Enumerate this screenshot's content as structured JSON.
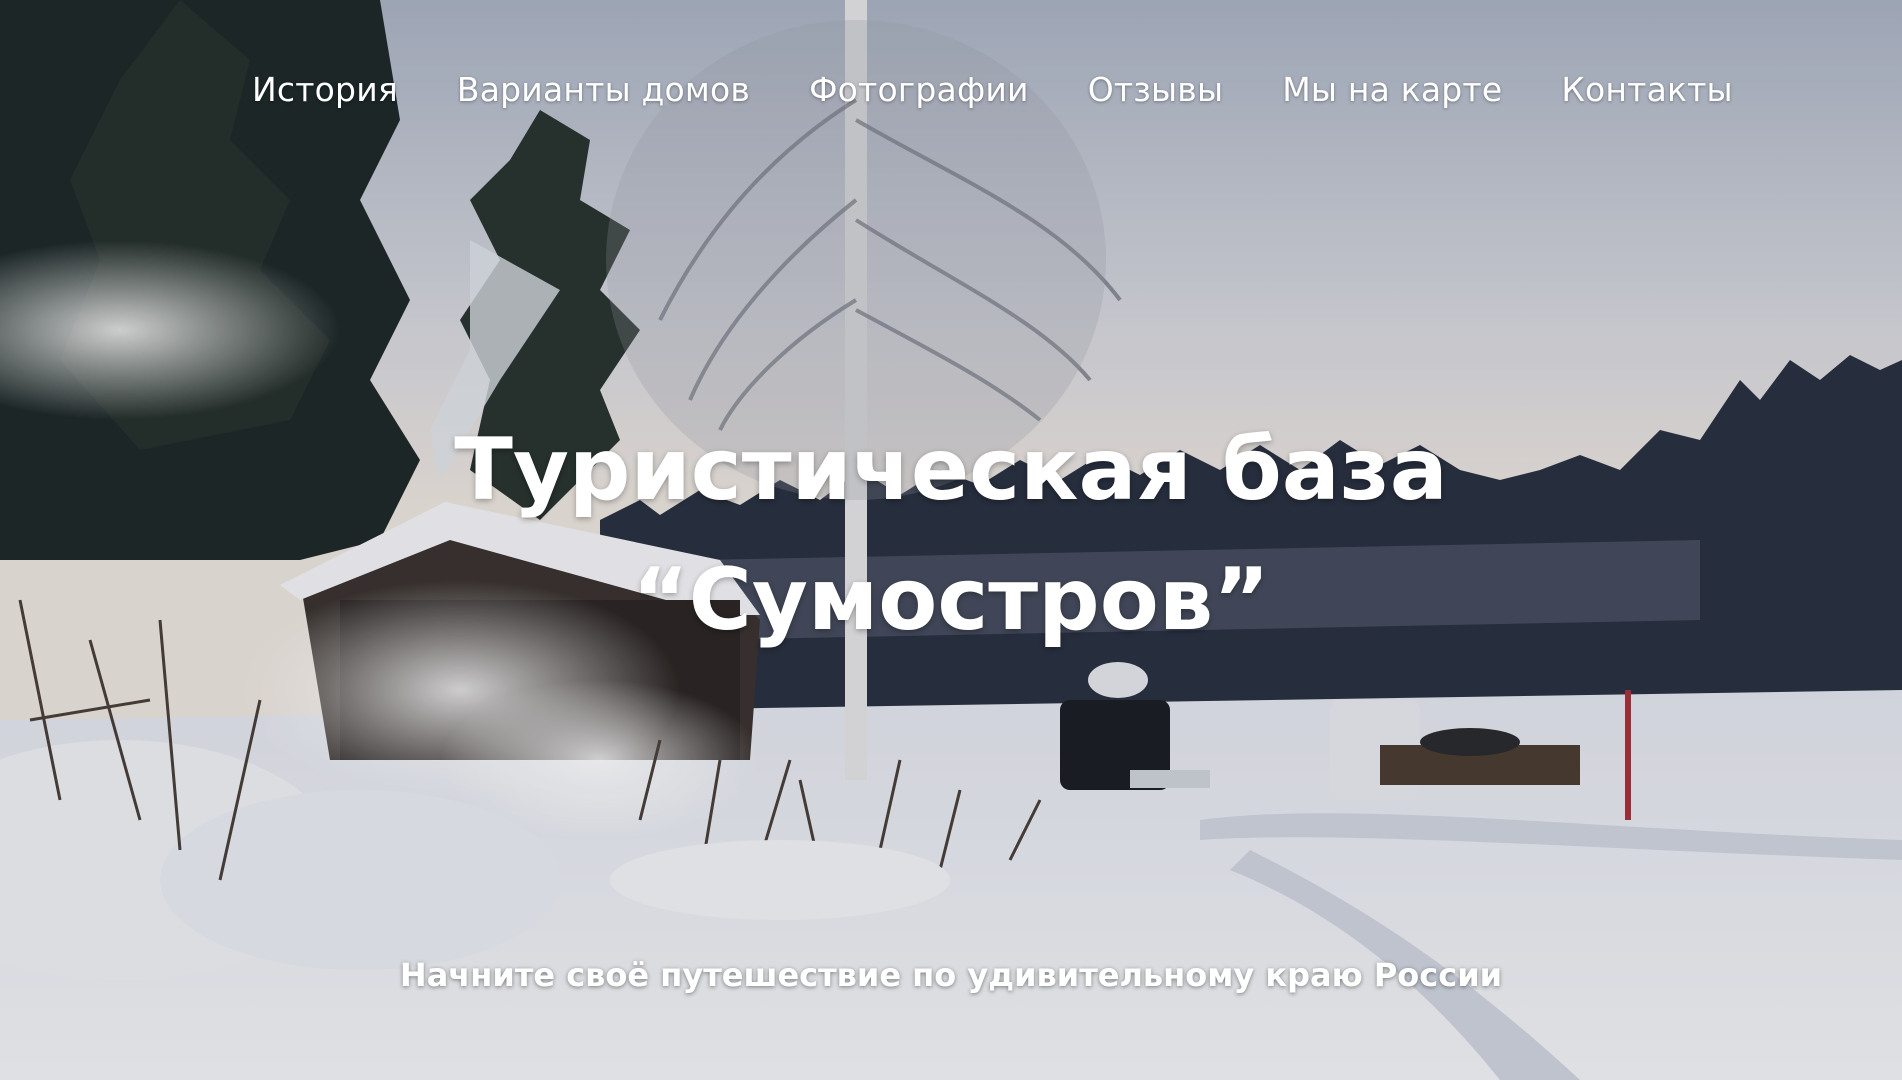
{
  "nav": {
    "items": [
      {
        "label": "История"
      },
      {
        "label": "Варианты домов"
      },
      {
        "label": "Фотографии"
      },
      {
        "label": "Отзывы"
      },
      {
        "label": "Мы на карте"
      },
      {
        "label": "Контакты"
      }
    ]
  },
  "hero": {
    "title_line1": "Туристическая база",
    "title_line2": "“Сумостров”",
    "subtitle": "Начните своё путешествие по удивительному краю России"
  },
  "colors": {
    "sky_top": "#b4bccb",
    "sky_bottom": "#e8e2dc",
    "forest": "#2b3343",
    "snow": "#eceef4",
    "text": "#ffffff"
  }
}
